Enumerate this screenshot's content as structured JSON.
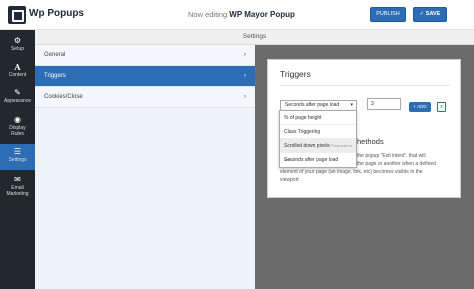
{
  "app": {
    "brand": "Wp Popups"
  },
  "header": {
    "editing_prefix": "Now editing",
    "popup_name": "WP Mayor Popup",
    "publish_label": "PUBLISH",
    "save_label": "SAVE"
  },
  "rail": {
    "items": [
      {
        "label": "Setup",
        "icon": "gear-icon",
        "glyph": "⚙"
      },
      {
        "label": "Content",
        "icon": "text-icon",
        "glyph": "A"
      },
      {
        "label": "Appearance",
        "icon": "brush-icon",
        "glyph": "✎"
      },
      {
        "label": "Display Rules",
        "icon": "eye-icon",
        "glyph": "◉"
      },
      {
        "label": "Settings",
        "icon": "sliders-icon",
        "glyph": "☰"
      },
      {
        "label": "Email Marketing",
        "icon": "megaphone-icon",
        "glyph": "✉"
      }
    ],
    "active": "Settings"
  },
  "settings": {
    "title": "Settings",
    "menu": [
      {
        "label": "General"
      },
      {
        "label": "Triggers"
      },
      {
        "label": "Cookies/Close"
      }
    ],
    "active": "Triggers"
  },
  "triggers": {
    "title": "Triggers",
    "selected": "Seconds after page load",
    "number_value": "3",
    "add_label": "ADD",
    "remove_label": "x",
    "dropdown_options": [
      "% of page height",
      "Class Triggering",
      "Scrolled down pixels",
      "Seconds after page load"
    ],
    "hover_hint": "Press enter to select",
    "heading_fragment": "hethods",
    "description_lines": [
      "the popup \"Exit intent\", that will",
      "the page or another when a defined",
      "element of your page (an image, link, etc) becomes visible in the",
      "viewport"
    ]
  }
}
